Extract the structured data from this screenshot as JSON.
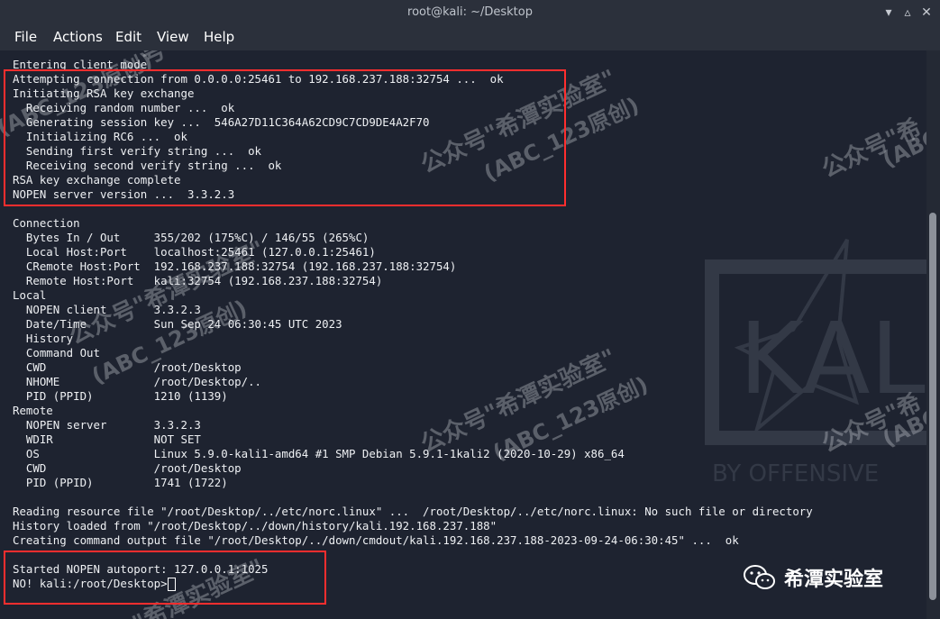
{
  "window": {
    "title": "root@kali: ~/Desktop",
    "minimize_icon": "minimize-icon",
    "maximize_icon": "maximize-icon",
    "close_icon": "close-icon"
  },
  "menu": {
    "items": [
      {
        "label": "File"
      },
      {
        "label": "Actions"
      },
      {
        "label": "Edit"
      },
      {
        "label": "View"
      },
      {
        "label": "Help"
      }
    ]
  },
  "terminal": {
    "lines": [
      "Entering client mode",
      "Attempting connection from 0.0.0.0:25461 to 192.168.237.188:32754 ...  ok",
      "Initiating RSA key exchange",
      "  Receiving random number ...  ok",
      "  Generating session key ...  546A27D11C364A62CD9C7CD9DE4A2F70",
      "  Initializing RC6 ...  ok",
      "  Sending first verify string ...  ok",
      "  Receiving second verify string ...  ok",
      "RSA key exchange complete",
      "NOPEN server version ...  3.3.2.3",
      "",
      "Connection",
      "  Bytes In / Out     355/202 (175%C) / 146/55 (265%C)",
      "  Local Host:Port    localhost:25461 (127.0.0.1:25461)",
      "  CRemote Host:Port  192.168.237.188:32754 (192.168.237.188:32754)",
      "  Remote Host:Port   kali:32754 (192.168.237.188:32754)",
      "Local",
      "  NOPEN client       3.3.2.3",
      "  Date/Time          Sun Sep 24 06:30:45 UTC 2023",
      "  History",
      "  Command Out",
      "  CWD                /root/Desktop",
      "  NHOME              /root/Desktop/..",
      "  PID (PPID)         1210 (1139)",
      "Remote",
      "  NOPEN server       3.3.2.3",
      "  WDIR               NOT SET",
      "  OS                 Linux 5.9.0-kali1-amd64 #1 SMP Debian 5.9.1-1kali2 (2020-10-29) x86_64",
      "  CWD                /root/Desktop",
      "  PID (PPID)         1741 (1722)",
      "",
      "Reading resource file \"/root/Desktop/../etc/norc.linux\" ...  /root/Desktop/../etc/norc.linux: No such file or directory",
      "History loaded from \"/root/Desktop/../down/history/kali.192.168.237.188\"",
      "Creating command output file \"/root/Desktop/../down/cmdout/kali.192.168.237.188-2023-09-24-06:30:45\" ...  ok",
      "",
      "Started NOPEN autoport: 127.0.0.1:1025"
    ],
    "prompt": "NO! kali:/root/Desktop>"
  },
  "watermark": {
    "line1": "公众号\"希潭实验室\"",
    "line2": "(ABC_123原创)",
    "fragment_a": "号\"希潭实验室\"",
    "fragment_b": "(ABC_123原创)",
    "fragment_c": "公众号\"希",
    "fragment_d": "(ABC",
    "fragment_e": "\"希潭实验室\"",
    "fragment_f": "公众号\"希",
    "fragment_g": "(ABC_"
  },
  "branding": {
    "text": "希潭实验室",
    "icon": "wechat-icon"
  },
  "background": {
    "logo_text": "KAL",
    "logo_sub": "BY OFFENSIVE"
  },
  "colors": {
    "terminal_bg": "#1e2330",
    "text": "#eef0f3",
    "highlight": "#ff2e2e",
    "menubar": "#2b303b"
  }
}
